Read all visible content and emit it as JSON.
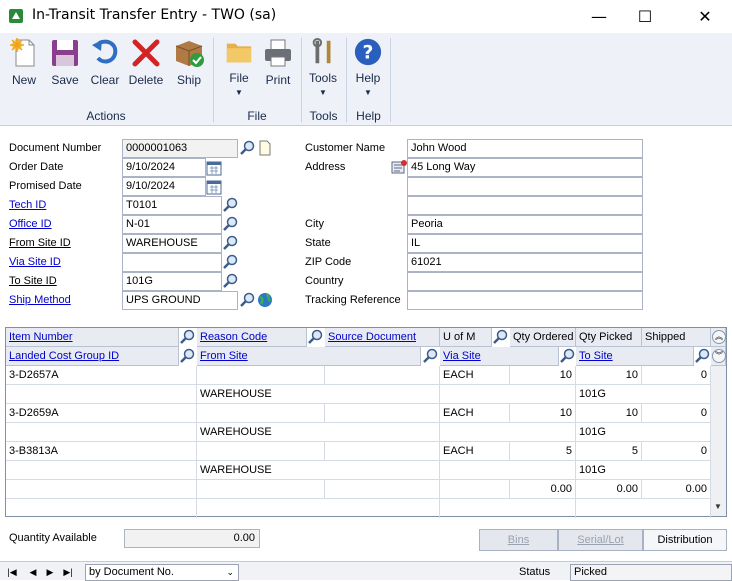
{
  "window": {
    "title": "In-Transit Transfer Entry  -  TWO (sa)",
    "minimize_glyph": "—",
    "maximize_glyph": "☐",
    "close_glyph": "✕"
  },
  "ribbon": {
    "buttons": {
      "new": "New",
      "save": "Save",
      "clear": "Clear",
      "delete": "Delete",
      "ship": "Ship",
      "file": "File",
      "print": "Print",
      "tools": "Tools",
      "help": "Help"
    },
    "groups": {
      "actions": "Actions",
      "file": "File",
      "tools": "Tools",
      "help": "Help"
    },
    "dropdown_arrow": "▼"
  },
  "header": {
    "labels": {
      "document_number": "Document Number",
      "order_date": "Order Date",
      "promised_date": "Promised Date",
      "tech_id": "Tech ID",
      "office_id": "Office ID",
      "from_site_id": "From Site ID",
      "via_site_id": "Via Site ID",
      "to_site_id": "To Site ID",
      "ship_method": "Ship Method",
      "customer_name": "Customer Name",
      "address": "Address",
      "city": "City",
      "state": "State",
      "zip_code": "ZIP Code",
      "country": "Country",
      "tracking_reference": "Tracking Reference"
    },
    "values": {
      "document_number": "0000001063",
      "order_date": "9/10/2024",
      "promised_date": "9/10/2024",
      "tech_id": "T0101",
      "office_id": "N-01",
      "from_site_id": "WAREHOUSE",
      "via_site_id": "",
      "to_site_id": "101G",
      "ship_method": "UPS GROUND",
      "customer_name": "John Wood",
      "address1": "45 Long Way",
      "address2": "",
      "address3": "",
      "city": "Peoria",
      "state": "IL",
      "zip_code": "61021",
      "country": "",
      "tracking_reference": ""
    }
  },
  "grid": {
    "headers_row1": {
      "item_number": "Item Number",
      "reason_code": "Reason Code",
      "source_document": "Source Document",
      "u_of_m": "U of M",
      "qty_ordered": "Qty Ordered",
      "qty_picked": "Qty Picked",
      "shipped": "Shipped"
    },
    "headers_row2": {
      "landed_cost_group_id": "Landed Cost Group ID",
      "from_site": "From Site",
      "via_site": "Via Site",
      "to_site": "To Site"
    },
    "lines": [
      {
        "item_number": "3-D2657A",
        "u_of_m": "EACH",
        "qty_ordered": "10",
        "qty_picked": "10",
        "shipped": "0",
        "from_site": "WAREHOUSE",
        "to_site": "101G"
      },
      {
        "item_number": "3-D2659A",
        "u_of_m": "EACH",
        "qty_ordered": "10",
        "qty_picked": "10",
        "shipped": "0",
        "from_site": "WAREHOUSE",
        "to_site": "101G"
      },
      {
        "item_number": "3-B3813A",
        "u_of_m": "EACH",
        "qty_ordered": "5",
        "qty_picked": "5",
        "shipped": "0",
        "from_site": "WAREHOUSE",
        "to_site": "101G"
      }
    ],
    "blank_row": {
      "qty_ordered": "0.00",
      "qty_picked": "0.00",
      "shipped": "0.00"
    }
  },
  "footer": {
    "quantity_available_label": "Quantity Available",
    "quantity_available": "0.00",
    "bins_button": "Bins",
    "serial_lot_button": "Serial/Lot",
    "distribution_button": "Distribution",
    "sort_by": "by Document No.",
    "status_label": "Status",
    "status_value": "Picked"
  },
  "colors": {
    "link": "#0000cc",
    "ribbon_bg": "#eef2f8",
    "grid_header_bg": "#e8ecf2",
    "help_icon": "#2b5fbd"
  },
  "icons": [
    "app-icon",
    "new-icon",
    "save-icon",
    "clear-icon",
    "delete-icon",
    "ship-icon",
    "file-icon",
    "print-icon",
    "tools-icon",
    "help-icon",
    "lookup-icon",
    "note-icon",
    "calendar-icon",
    "address-icon",
    "globe-icon",
    "expand-icon",
    "collapse-icon",
    "scroll-down-icon"
  ]
}
